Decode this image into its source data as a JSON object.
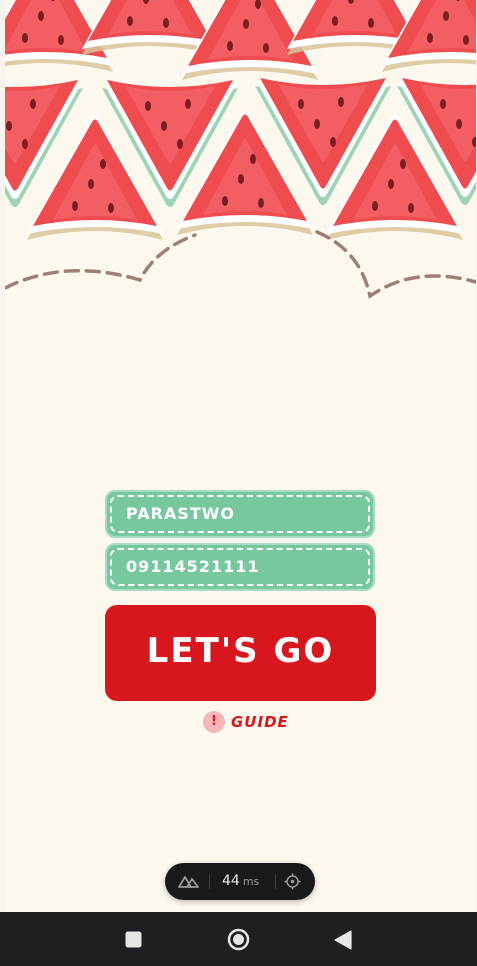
{
  "form": {
    "name_value": "PARASTWO",
    "phone_value": "09114521111",
    "submit_label": "LET'S GO"
  },
  "guide": {
    "icon": "!",
    "label": "GUIDE"
  },
  "perf_badge": {
    "value": "44",
    "unit": "ms"
  },
  "nav": {
    "icons": [
      "recents-square-icon",
      "home-circle-icon",
      "back-triangle-icon"
    ]
  },
  "colors": {
    "background": "#fcf8ee",
    "field_green": "#77c79f",
    "button_red": "#d8161e",
    "watermelon": "#ee4b4e",
    "rind_green": "#9fd3b6",
    "dashed_path": "#9d7f78"
  }
}
